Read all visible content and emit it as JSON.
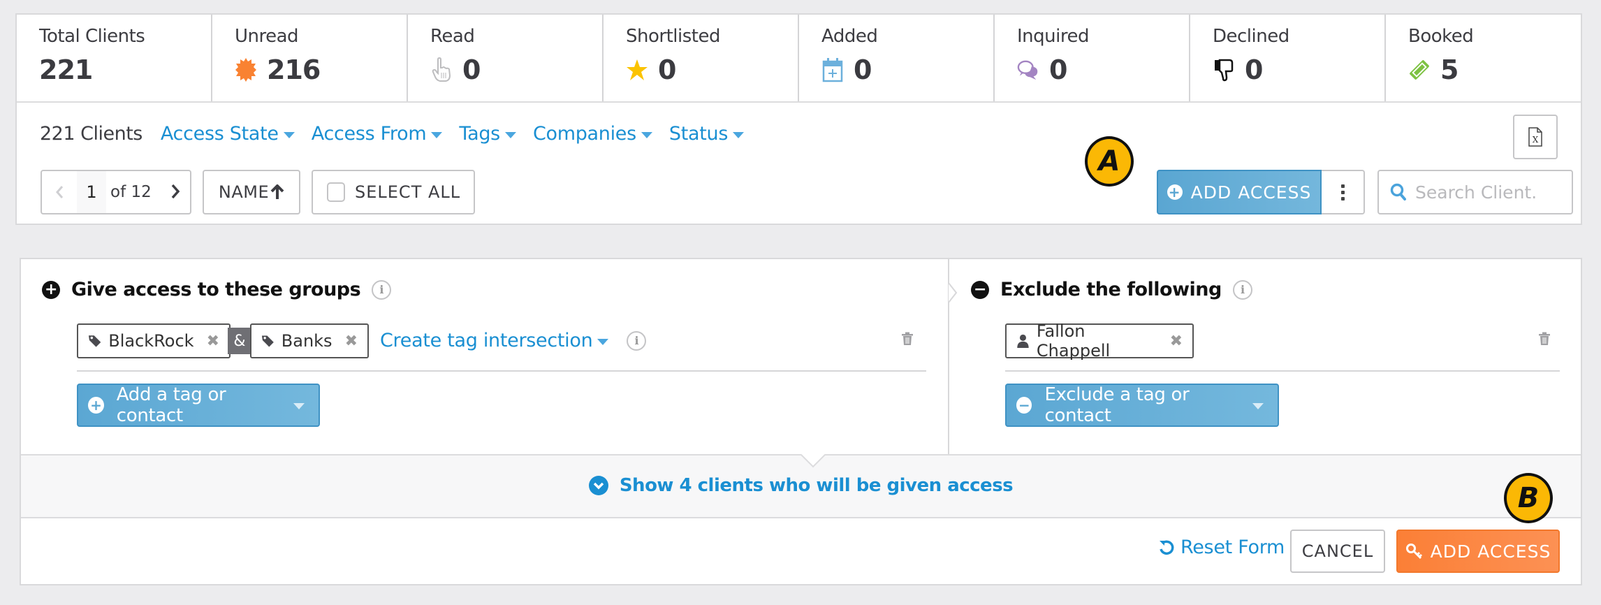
{
  "stats": [
    {
      "label": "Total Clients",
      "value": "221",
      "icon": "none"
    },
    {
      "label": "Unread",
      "value": "216",
      "icon": "starburst-icon",
      "color": "#f98232"
    },
    {
      "label": "Read",
      "value": "0",
      "icon": "pointer-hand-icon",
      "color": "#bdbdbf"
    },
    {
      "label": "Shortlisted",
      "value": "0",
      "icon": "star-icon",
      "color": "#fbc300"
    },
    {
      "label": "Added",
      "value": "0",
      "icon": "calendar-plus-icon",
      "color": "#6cb0dc"
    },
    {
      "label": "Inquired",
      "value": "0",
      "icon": "chat-bubbles-icon",
      "color": "#a384c2"
    },
    {
      "label": "Declined",
      "value": "0",
      "icon": "thumbs-down-icon",
      "color": "#111111"
    },
    {
      "label": "Booked",
      "value": "5",
      "icon": "ticket-icon",
      "color": "#7dc242"
    }
  ],
  "toolbar": {
    "clients_count": "221 Clients",
    "filters": [
      "Access State",
      "Access From",
      "Tags",
      "Companies",
      "Status"
    ],
    "pager": {
      "current": "1",
      "of_label": "of 12"
    },
    "sort_label": "NAME",
    "select_all_label": "SELECT ALL",
    "add_access_label": "ADD ACCESS",
    "search_placeholder": "Search Client."
  },
  "markers": {
    "a": "A",
    "b": "B"
  },
  "form": {
    "give": {
      "title": "Give access to these groups",
      "tags": [
        "BlackRock",
        "Banks"
      ],
      "join_symbol": "&",
      "intersection_link": "Create tag intersection",
      "add_button": "Add a tag or contact"
    },
    "exclude": {
      "title": "Exclude the following",
      "contacts": [
        "Fallon Chappell"
      ],
      "exclude_button": "Exclude a tag or contact"
    },
    "show_clients": "Show 4 clients who will be given access",
    "reset_label": "Reset Form",
    "cancel_label": "CANCEL",
    "submit_label": "ADD ACCESS"
  },
  "colors": {
    "link_blue": "#1a8fd2",
    "button_blue": "#5ba7d3",
    "submit_orange": "#fb7f36",
    "marker_yellow": "#fbb805"
  }
}
